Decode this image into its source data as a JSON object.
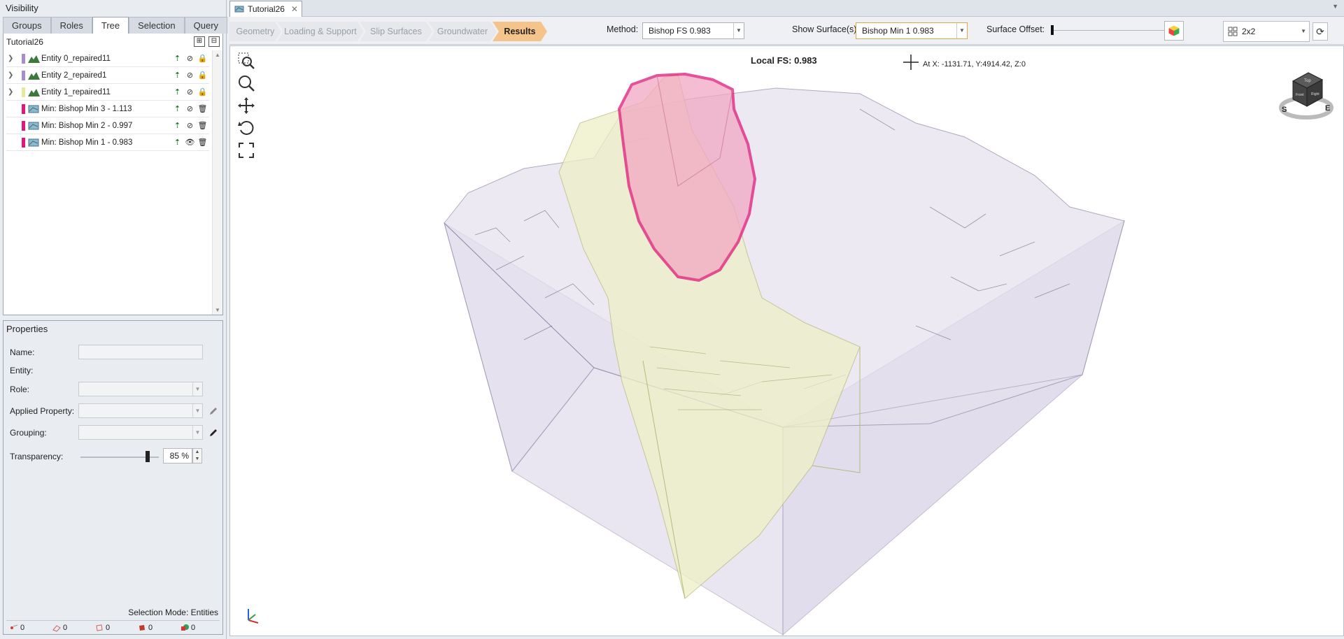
{
  "visibility": {
    "title": "Visibility",
    "tabs": [
      "Groups",
      "Roles",
      "Tree",
      "Selection",
      "Query"
    ],
    "active_tab": "Tree",
    "tree_root": "Tutorial26",
    "items": [
      {
        "label": "Entity 0_repaired11",
        "color": "#a98bd0",
        "type": "entity"
      },
      {
        "label": "Entity 2_repaired1",
        "color": "#a98bd0",
        "type": "entity"
      },
      {
        "label": "Entity 1_repaired11",
        "color": "#e6e89a",
        "type": "entity"
      },
      {
        "label": "Min: Bishop Min 3  -  1.113",
        "color": "#e0187a",
        "type": "surface"
      },
      {
        "label": "Min: Bishop Min 2  -  0.997",
        "color": "#e0187a",
        "type": "surface"
      },
      {
        "label": "Min: Bishop Min 1  -  0.983",
        "color": "#e0187a",
        "type": "surface"
      }
    ]
  },
  "properties": {
    "title": "Properties",
    "name_label": "Name:",
    "entity_label": "Entity:",
    "role_label": "Role:",
    "applied_property_label": "Applied Property:",
    "grouping_label": "Grouping:",
    "transparency_label": "Transparency:",
    "transparency_value": "85 %",
    "transparency_fraction": 0.85,
    "selection_mode": "Selection Mode:  Entities",
    "status_counts": [
      "0",
      "0",
      "0",
      "0",
      "0"
    ]
  },
  "document": {
    "tab_title": "Tutorial26"
  },
  "toolbar": {
    "steps": [
      "Geometry",
      "Loading & Support",
      "Slip Surfaces",
      "Groundwater",
      "Results"
    ],
    "active_step": "Results",
    "method_label": "Method:",
    "method_value": "Bishop FS    0.983",
    "show_surface_label": "Show Surface(s):",
    "show_surface_value": "Bishop Min 1  0.983",
    "surface_offset_label": "Surface Offset:",
    "layout_value": "2x2"
  },
  "viewport": {
    "local_fs": "Local FS: 0.983",
    "coords": "At X: -1131.71, Y:4914.42, Z:0",
    "navcube_faces": [
      "Top",
      "Front",
      "Right"
    ],
    "compass": [
      "S",
      "E"
    ]
  },
  "colors": {
    "accent": "#f5c48a",
    "slip_surface": "#e0187a",
    "slip_fill": "#f2a8c2",
    "entity_purple": "#a98bd0",
    "entity_yellow": "#e6e89a"
  }
}
